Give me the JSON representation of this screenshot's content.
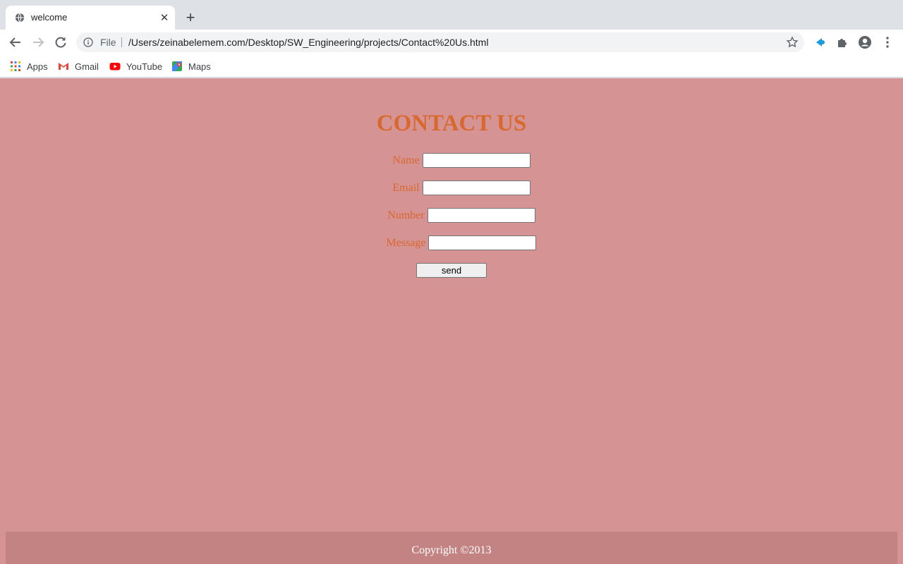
{
  "browser": {
    "tab": {
      "title": "welcome",
      "favicon": "globe-icon"
    },
    "new_tab_label": "+",
    "close_label": "✕",
    "address": {
      "scheme": "File",
      "url": "/Users/zeinabelemem.com/Desktop/SW_Engineering/projects/Contact%20Us.html"
    },
    "bookmarks": [
      {
        "label": "Apps",
        "icon": "apps-grid-icon"
      },
      {
        "label": "Gmail",
        "icon": "gmail-icon"
      },
      {
        "label": "YouTube",
        "icon": "youtube-icon"
      },
      {
        "label": "Maps",
        "icon": "maps-icon"
      }
    ]
  },
  "page": {
    "heading": "CONTACT US",
    "form": {
      "fields": [
        {
          "label": "Name",
          "value": ""
        },
        {
          "label": "Email",
          "value": ""
        },
        {
          "label": "Number",
          "value": ""
        },
        {
          "label": "Message",
          "value": ""
        }
      ],
      "submit_label": "send"
    },
    "footer": "Copyright ©2013"
  },
  "colors": {
    "page_background": "#d69393",
    "accent_text": "#d9682e",
    "footer_background": "#c48383"
  }
}
